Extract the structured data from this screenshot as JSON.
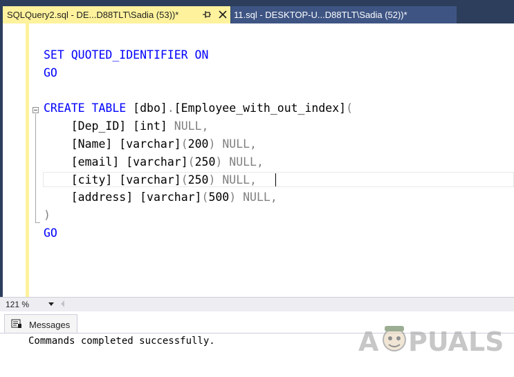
{
  "tabs": [
    {
      "label": "SQLQuery2.sql - DE...D88TLT\\Sadia (53))*",
      "active": true
    },
    {
      "label": "11.sql - DESKTOP-U...D88TLT\\Sadia (52))*",
      "active": false
    }
  ],
  "editor": {
    "lines": [
      {
        "tokens": [
          {
            "t": "SET QUOTED_IDENTIFIER ON",
            "c": "kw"
          }
        ]
      },
      {
        "tokens": [
          {
            "t": "GO",
            "c": "kw"
          }
        ]
      },
      {
        "tokens": []
      },
      {
        "tokens": [
          {
            "t": "CREATE TABLE ",
            "c": "kw"
          },
          {
            "t": "[dbo]",
            "c": "ident"
          },
          {
            "t": ".",
            "c": "gray"
          },
          {
            "t": "[Employee_with_out_index]",
            "c": "ident"
          },
          {
            "t": "(",
            "c": "gray"
          }
        ]
      },
      {
        "tokens": [
          {
            "t": "    ",
            "c": "ident"
          },
          {
            "t": "[Dep_ID] [int] ",
            "c": "ident"
          },
          {
            "t": "NULL,",
            "c": "gray"
          }
        ]
      },
      {
        "tokens": [
          {
            "t": "    ",
            "c": "ident"
          },
          {
            "t": "[Name] [varchar]",
            "c": "ident"
          },
          {
            "t": "(",
            "c": "gray"
          },
          {
            "t": "200",
            "c": "ident"
          },
          {
            "t": ") NULL,",
            "c": "gray"
          }
        ]
      },
      {
        "tokens": [
          {
            "t": "    ",
            "c": "ident"
          },
          {
            "t": "[email] [varchar]",
            "c": "ident"
          },
          {
            "t": "(",
            "c": "gray"
          },
          {
            "t": "250",
            "c": "ident"
          },
          {
            "t": ") NULL,",
            "c": "gray"
          }
        ]
      },
      {
        "tokens": [
          {
            "t": "    ",
            "c": "ident"
          },
          {
            "t": "[city] [varchar]",
            "c": "ident"
          },
          {
            "t": "(",
            "c": "gray"
          },
          {
            "t": "250",
            "c": "ident"
          },
          {
            "t": ") NULL,",
            "c": "gray"
          }
        ]
      },
      {
        "tokens": [
          {
            "t": "    ",
            "c": "ident"
          },
          {
            "t": "[address] [varchar]",
            "c": "ident"
          },
          {
            "t": "(",
            "c": "gray"
          },
          {
            "t": "500",
            "c": "ident"
          },
          {
            "t": ") NULL,",
            "c": "gray"
          }
        ]
      },
      {
        "tokens": [
          {
            "t": ")",
            "c": "gray"
          }
        ]
      },
      {
        "tokens": [
          {
            "t": "GO",
            "c": "kw"
          }
        ]
      }
    ]
  },
  "zoom": {
    "value": "121 %"
  },
  "results": {
    "tab_label": "Messages",
    "message": "Commands completed successfully."
  },
  "watermark": {
    "text": "APPUALS"
  },
  "colors": {
    "tab_active_bg": "#fff29d",
    "tab_inactive_bg": "#3e5584",
    "chrome_dark": "#2d3e5c",
    "keyword": "#0000ff",
    "operator": "#808080"
  }
}
